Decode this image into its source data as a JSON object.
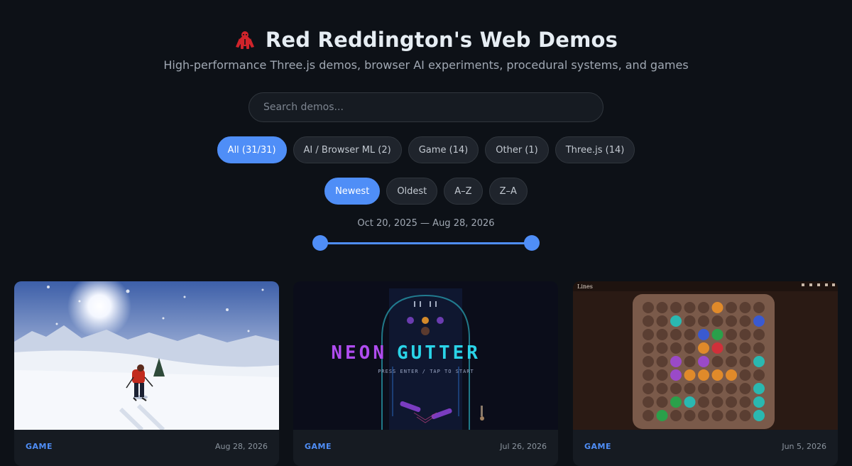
{
  "header": {
    "title": "Red Reddington's Web Demos",
    "subtitle": "High-performance Three.js demos, browser AI experiments, procedural systems, and games",
    "logo_icon": "gorilla-icon",
    "logo_color": "#d0242b"
  },
  "search": {
    "placeholder": "Search demos..."
  },
  "filters": [
    {
      "label": "All (31/31)",
      "active": true
    },
    {
      "label": "AI / Browser ML (2)",
      "active": false
    },
    {
      "label": "Game (14)",
      "active": false
    },
    {
      "label": "Other (1)",
      "active": false
    },
    {
      "label": "Three.js (14)",
      "active": false
    }
  ],
  "sorts": [
    {
      "label": "Newest",
      "active": true
    },
    {
      "label": "Oldest",
      "active": false
    },
    {
      "label": "A–Z",
      "active": false
    },
    {
      "label": "Z–A",
      "active": false
    }
  ],
  "date_range": {
    "label": "Oct 20, 2025 — Aug 28, 2026",
    "start": "Oct 20, 2025",
    "end": "Aug 28, 2026"
  },
  "cards": [
    {
      "category": "GAME",
      "date": "Aug 28, 2026",
      "thumbnail": "skiing-scene"
    },
    {
      "category": "GAME",
      "date": "Jul 26, 2026",
      "thumbnail": "neon-gutter-pinball",
      "thumb_title_a": "NEON",
      "thumb_title_b": "GUTTER",
      "thumb_caption": "PRESS ENTER / TAP TO START"
    },
    {
      "category": "GAME",
      "date": "Jun 5, 2026",
      "thumbnail": "lines-marble-board",
      "thumb_title": "Lines"
    }
  ],
  "colors": {
    "accent": "#4f8ef7",
    "background": "#0d1117",
    "neon_purple": "#b04cf0",
    "neon_cyan": "#2ad4e8"
  }
}
